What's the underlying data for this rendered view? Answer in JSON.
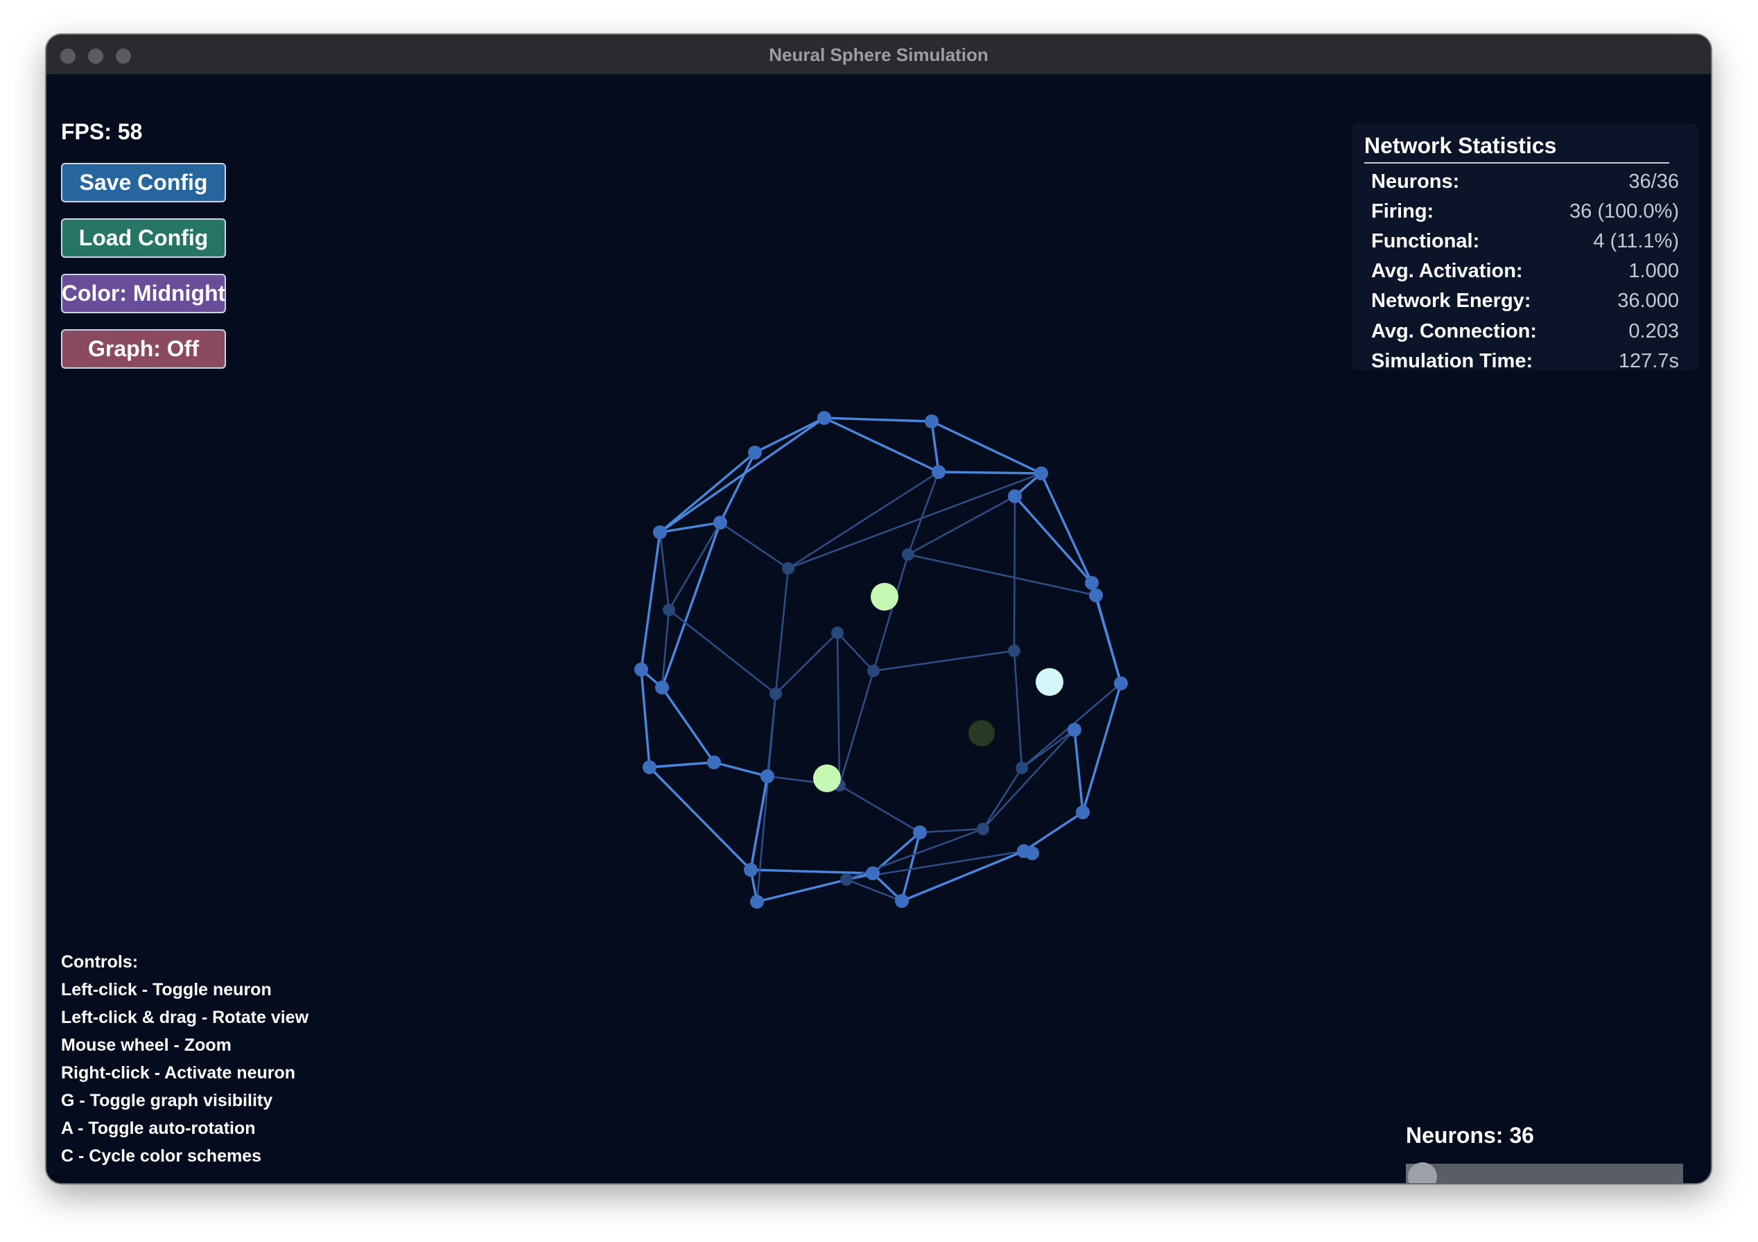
{
  "window": {
    "title": "Neural Sphere Simulation"
  },
  "hud": {
    "fps": "FPS: 58"
  },
  "buttons": {
    "save": "Save Config",
    "load": "Load Config",
    "color": "Color: Midnight",
    "graph": "Graph: Off"
  },
  "stats": {
    "title": "Network Statistics",
    "rows": [
      {
        "label": "Neurons:",
        "value": "36/36"
      },
      {
        "label": "Firing:",
        "value": "36 (100.0%)"
      },
      {
        "label": "Functional:",
        "value": "4 (11.1%)"
      },
      {
        "label": "Avg. Activation:",
        "value": "1.000"
      },
      {
        "label": "Network Energy:",
        "value": "36.000"
      },
      {
        "label": "Avg. Connection:",
        "value": "0.203"
      },
      {
        "label": "Simulation Time:",
        "value": "127.7s"
      }
    ]
  },
  "controls": {
    "heading": "Controls:",
    "lines": [
      "Left-click - Toggle neuron",
      "Left-click & drag - Rotate view",
      "Mouse wheel - Zoom",
      "Right-click - Activate neuron",
      "G - Toggle graph visibility",
      "A - Toggle auto-rotation",
      "C - Cycle color schemes"
    ]
  },
  "slider": {
    "label": "Neurons: 36",
    "value": 36,
    "fraction": 0.05
  },
  "colors": {
    "background": "#050c1d",
    "edge": "#4a86dc",
    "node": "#3c6fbf",
    "active_green": "#c6f7b3",
    "active_cyan": "#d2f6fa",
    "dim_node": "#283a24"
  }
}
